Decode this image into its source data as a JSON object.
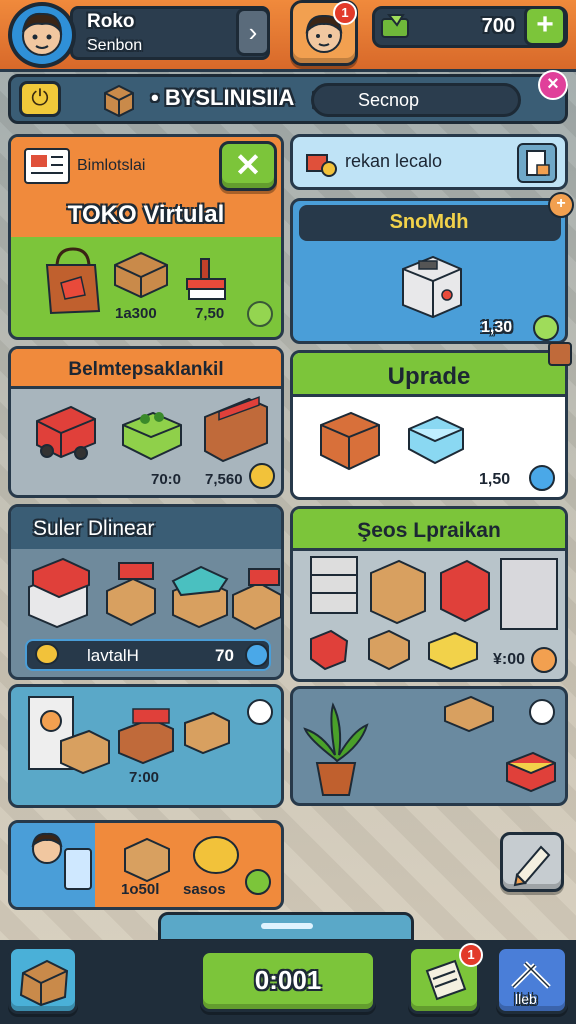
{
  "header": {
    "player_name": "Roko",
    "player_sub": "Senbon",
    "friend_badge": "1",
    "cash_value": "700",
    "plus_label": "+"
  },
  "navbar": {
    "title": "• BYSLINISIIA",
    "search_text": "Secnop",
    "close_label": "×"
  },
  "panels": {
    "toko": {
      "tag": "Bimlotslai",
      "title": "TOKO Virtulal",
      "close_label": "✕",
      "prices": [
        "1a300",
        "7,50"
      ]
    },
    "lecalo": {
      "title": "rekan lecalo"
    },
    "snomdh": {
      "title": "SnoMdh",
      "price": "1,30"
    },
    "belm": {
      "title": "Belmtepsaklankil",
      "prices": [
        "70:0",
        "7,560"
      ]
    },
    "upgrade": {
      "title": "Uprade",
      "price": "1,50"
    },
    "suller": {
      "title": "Suler Dlinear",
      "bar_label": "lavtalH",
      "bar_value": "70"
    },
    "sevs": {
      "title": "Şeos Lpraikan",
      "price": "¥:00"
    },
    "shelf": {
      "price": "7:00"
    },
    "profile": {
      "prices": [
        "1o50l",
        "sasos"
      ]
    }
  },
  "bottom": {
    "center_value": "0:001",
    "right_badge": "1",
    "right_label": "lleb"
  },
  "colors": {
    "orange": "#f08a3c",
    "green": "#7cc53a",
    "navy": "#27394a",
    "sky": "#8fc6ec"
  },
  "icons": [
    "user-avatar-icon",
    "chevron-right-icon",
    "cash-icon",
    "plus-icon",
    "power-icon",
    "box-icon",
    "shop-icon",
    "close-icon",
    "bag-icon",
    "safe-icon",
    "truck-icon",
    "plant-icon",
    "pencil-icon",
    "gift-icon"
  ]
}
